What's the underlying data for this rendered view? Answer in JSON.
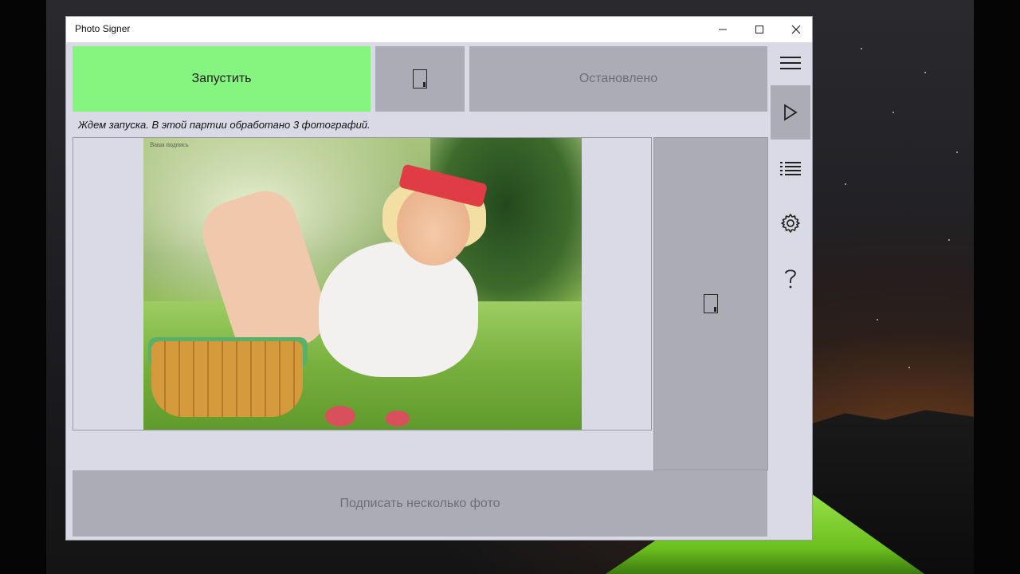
{
  "window": {
    "title": "Photo Signer",
    "controls": {
      "minimize": "—",
      "maximize": "☐",
      "close": "✕"
    }
  },
  "toolbar": {
    "start_label": "Запустить",
    "status_label": "Остановлено"
  },
  "status_message": "Ждем запуска. В этой партии обработано 3 фотографий.",
  "preview": {
    "watermark_text": "Ваша подпись"
  },
  "actions": {
    "sign_multiple_label": "Подписать несколько фото"
  },
  "rail": {
    "items": [
      {
        "icon": "hamburger-menu-icon"
      },
      {
        "icon": "play-icon",
        "active": true
      },
      {
        "icon": "list-icon"
      },
      {
        "icon": "gear-icon"
      },
      {
        "icon": "question-icon"
      }
    ]
  },
  "colors": {
    "start_button": "#86f57f",
    "tile_gray": "#acacb7",
    "window_bg": "#d9dae6"
  }
}
